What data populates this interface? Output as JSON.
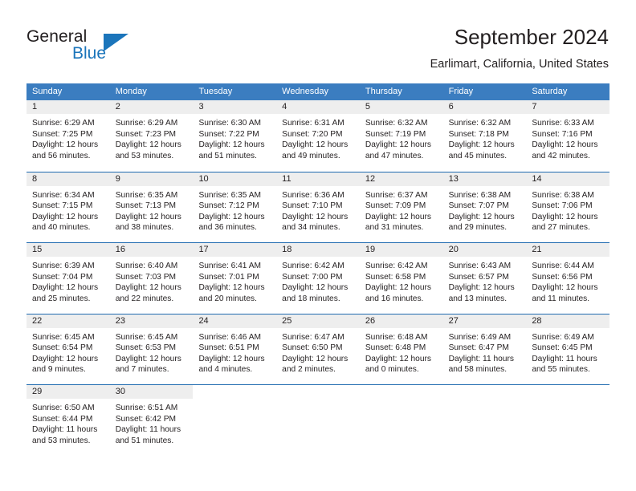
{
  "logo": {
    "word_one": "General",
    "word_two": "Blue",
    "triangle": "triangle-mark",
    "brand_color": "#1b75bb"
  },
  "header": {
    "title": "September 2024",
    "subtitle": "Earlimart, California, United States"
  },
  "calendar": {
    "header_bg": "#3b7dc0",
    "row_divider": "#1f6bb0",
    "day_strip_bg": "#eeeeee",
    "weekdays": [
      "Sunday",
      "Monday",
      "Tuesday",
      "Wednesday",
      "Thursday",
      "Friday",
      "Saturday"
    ],
    "weeks": [
      [
        {
          "day": "1",
          "sunrise": "Sunrise: 6:29 AM",
          "sunset": "Sunset: 7:25 PM",
          "daylight": "Daylight: 12 hours and 56 minutes."
        },
        {
          "day": "2",
          "sunrise": "Sunrise: 6:29 AM",
          "sunset": "Sunset: 7:23 PM",
          "daylight": "Daylight: 12 hours and 53 minutes."
        },
        {
          "day": "3",
          "sunrise": "Sunrise: 6:30 AM",
          "sunset": "Sunset: 7:22 PM",
          "daylight": "Daylight: 12 hours and 51 minutes."
        },
        {
          "day": "4",
          "sunrise": "Sunrise: 6:31 AM",
          "sunset": "Sunset: 7:20 PM",
          "daylight": "Daylight: 12 hours and 49 minutes."
        },
        {
          "day": "5",
          "sunrise": "Sunrise: 6:32 AM",
          "sunset": "Sunset: 7:19 PM",
          "daylight": "Daylight: 12 hours and 47 minutes."
        },
        {
          "day": "6",
          "sunrise": "Sunrise: 6:32 AM",
          "sunset": "Sunset: 7:18 PM",
          "daylight": "Daylight: 12 hours and 45 minutes."
        },
        {
          "day": "7",
          "sunrise": "Sunrise: 6:33 AM",
          "sunset": "Sunset: 7:16 PM",
          "daylight": "Daylight: 12 hours and 42 minutes."
        }
      ],
      [
        {
          "day": "8",
          "sunrise": "Sunrise: 6:34 AM",
          "sunset": "Sunset: 7:15 PM",
          "daylight": "Daylight: 12 hours and 40 minutes."
        },
        {
          "day": "9",
          "sunrise": "Sunrise: 6:35 AM",
          "sunset": "Sunset: 7:13 PM",
          "daylight": "Daylight: 12 hours and 38 minutes."
        },
        {
          "day": "10",
          "sunrise": "Sunrise: 6:35 AM",
          "sunset": "Sunset: 7:12 PM",
          "daylight": "Daylight: 12 hours and 36 minutes."
        },
        {
          "day": "11",
          "sunrise": "Sunrise: 6:36 AM",
          "sunset": "Sunset: 7:10 PM",
          "daylight": "Daylight: 12 hours and 34 minutes."
        },
        {
          "day": "12",
          "sunrise": "Sunrise: 6:37 AM",
          "sunset": "Sunset: 7:09 PM",
          "daylight": "Daylight: 12 hours and 31 minutes."
        },
        {
          "day": "13",
          "sunrise": "Sunrise: 6:38 AM",
          "sunset": "Sunset: 7:07 PM",
          "daylight": "Daylight: 12 hours and 29 minutes."
        },
        {
          "day": "14",
          "sunrise": "Sunrise: 6:38 AM",
          "sunset": "Sunset: 7:06 PM",
          "daylight": "Daylight: 12 hours and 27 minutes."
        }
      ],
      [
        {
          "day": "15",
          "sunrise": "Sunrise: 6:39 AM",
          "sunset": "Sunset: 7:04 PM",
          "daylight": "Daylight: 12 hours and 25 minutes."
        },
        {
          "day": "16",
          "sunrise": "Sunrise: 6:40 AM",
          "sunset": "Sunset: 7:03 PM",
          "daylight": "Daylight: 12 hours and 22 minutes."
        },
        {
          "day": "17",
          "sunrise": "Sunrise: 6:41 AM",
          "sunset": "Sunset: 7:01 PM",
          "daylight": "Daylight: 12 hours and 20 minutes."
        },
        {
          "day": "18",
          "sunrise": "Sunrise: 6:42 AM",
          "sunset": "Sunset: 7:00 PM",
          "daylight": "Daylight: 12 hours and 18 minutes."
        },
        {
          "day": "19",
          "sunrise": "Sunrise: 6:42 AM",
          "sunset": "Sunset: 6:58 PM",
          "daylight": "Daylight: 12 hours and 16 minutes."
        },
        {
          "day": "20",
          "sunrise": "Sunrise: 6:43 AM",
          "sunset": "Sunset: 6:57 PM",
          "daylight": "Daylight: 12 hours and 13 minutes."
        },
        {
          "day": "21",
          "sunrise": "Sunrise: 6:44 AM",
          "sunset": "Sunset: 6:56 PM",
          "daylight": "Daylight: 12 hours and 11 minutes."
        }
      ],
      [
        {
          "day": "22",
          "sunrise": "Sunrise: 6:45 AM",
          "sunset": "Sunset: 6:54 PM",
          "daylight": "Daylight: 12 hours and 9 minutes."
        },
        {
          "day": "23",
          "sunrise": "Sunrise: 6:45 AM",
          "sunset": "Sunset: 6:53 PM",
          "daylight": "Daylight: 12 hours and 7 minutes."
        },
        {
          "day": "24",
          "sunrise": "Sunrise: 6:46 AM",
          "sunset": "Sunset: 6:51 PM",
          "daylight": "Daylight: 12 hours and 4 minutes."
        },
        {
          "day": "25",
          "sunrise": "Sunrise: 6:47 AM",
          "sunset": "Sunset: 6:50 PM",
          "daylight": "Daylight: 12 hours and 2 minutes."
        },
        {
          "day": "26",
          "sunrise": "Sunrise: 6:48 AM",
          "sunset": "Sunset: 6:48 PM",
          "daylight": "Daylight: 12 hours and 0 minutes."
        },
        {
          "day": "27",
          "sunrise": "Sunrise: 6:49 AM",
          "sunset": "Sunset: 6:47 PM",
          "daylight": "Daylight: 11 hours and 58 minutes."
        },
        {
          "day": "28",
          "sunrise": "Sunrise: 6:49 AM",
          "sunset": "Sunset: 6:45 PM",
          "daylight": "Daylight: 11 hours and 55 minutes."
        }
      ],
      [
        {
          "day": "29",
          "sunrise": "Sunrise: 6:50 AM",
          "sunset": "Sunset: 6:44 PM",
          "daylight": "Daylight: 11 hours and 53 minutes."
        },
        {
          "day": "30",
          "sunrise": "Sunrise: 6:51 AM",
          "sunset": "Sunset: 6:42 PM",
          "daylight": "Daylight: 11 hours and 51 minutes."
        },
        {
          "day": "",
          "sunrise": "",
          "sunset": "",
          "daylight": ""
        },
        {
          "day": "",
          "sunrise": "",
          "sunset": "",
          "daylight": ""
        },
        {
          "day": "",
          "sunrise": "",
          "sunset": "",
          "daylight": ""
        },
        {
          "day": "",
          "sunrise": "",
          "sunset": "",
          "daylight": ""
        },
        {
          "day": "",
          "sunrise": "",
          "sunset": "",
          "daylight": ""
        }
      ]
    ]
  }
}
